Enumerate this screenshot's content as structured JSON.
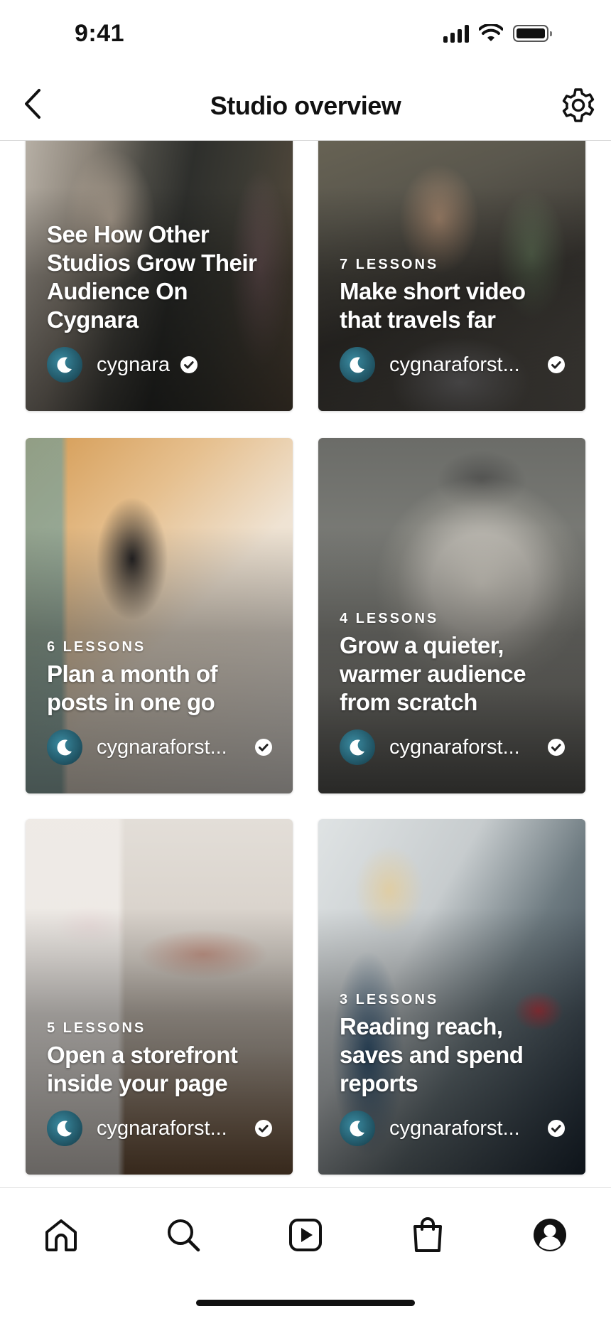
{
  "status_bar": {
    "time": "9:41"
  },
  "header": {
    "title": "Studio overview",
    "back_icon": "chevron-left-icon",
    "settings_icon": "gear-icon"
  },
  "cards": [
    {
      "lessons": "",
      "title": "See How Other Studios Grow Their Audience On Cygnara",
      "author": "cygnara",
      "image": "florist shop doorway"
    },
    {
      "lessons": "7 LESSONS",
      "title": "Make short video that travels far",
      "author": "cygnaraforst...",
      "image": "woman filming with phone"
    },
    {
      "lessons": "6 LESSONS",
      "title": "Plan a month of posts in one go",
      "author": "cygnaraforst...",
      "image": "pencils and planner"
    },
    {
      "lessons": "4 LESSONS",
      "title": "Grow a quieter, warmer audience from scratch",
      "author": "cygnaraforst...",
      "image": "pottery wheel"
    },
    {
      "lessons": "5 LESSONS",
      "title": "Open a storefront inside your page",
      "author": "cygnaraforst...",
      "image": "clothing boutique"
    },
    {
      "lessons": "3 LESSONS",
      "title": "Reading reach, saves and spend reports",
      "author": "cygnaraforst...",
      "image": "woman at laptop"
    }
  ],
  "tabbar": {
    "items": [
      {
        "icon": "home-icon"
      },
      {
        "icon": "search-icon"
      },
      {
        "icon": "reels-play-icon"
      },
      {
        "icon": "shopping-bag-icon"
      },
      {
        "icon": "profile-icon"
      }
    ]
  },
  "colors": {
    "avatar": "#2a6f82",
    "text_on_image": "#ffffff",
    "accent": "#111111"
  }
}
